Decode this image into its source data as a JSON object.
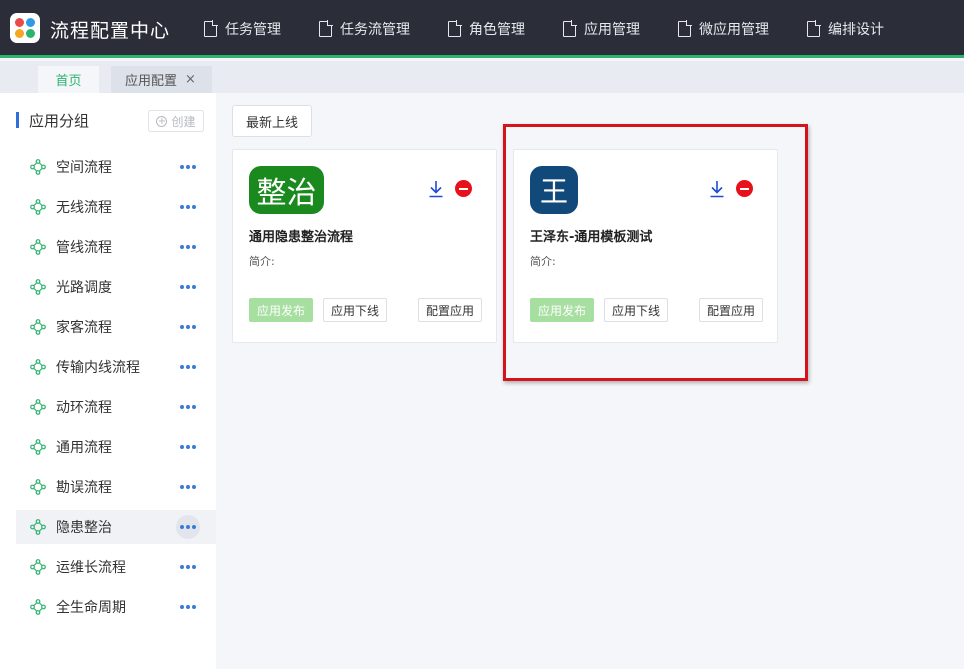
{
  "header": {
    "app_title": "流程配置中心",
    "logo_colors": [
      "#e94b4b",
      "#2f9be4",
      "#f5a623",
      "#2cb36d"
    ],
    "nav": [
      {
        "label": "任务管理"
      },
      {
        "label": "任务流管理"
      },
      {
        "label": "角色管理"
      },
      {
        "label": "应用管理"
      },
      {
        "label": "微应用管理"
      },
      {
        "label": "编排设计"
      }
    ]
  },
  "tabs": [
    {
      "label": "首页",
      "active": true
    },
    {
      "label": "应用配置",
      "active": false,
      "close_icon": "×"
    }
  ],
  "sidebar": {
    "title": "应用分组",
    "create_label": "创建",
    "items": [
      {
        "label": "空间流程",
        "active": false
      },
      {
        "label": "无线流程",
        "active": false
      },
      {
        "label": "管线流程",
        "active": false
      },
      {
        "label": "光路调度",
        "active": false
      },
      {
        "label": "家客流程",
        "active": false
      },
      {
        "label": "传输内线流程",
        "active": false
      },
      {
        "label": "动环流程",
        "active": false
      },
      {
        "label": "通用流程",
        "active": false
      },
      {
        "label": "勘误流程",
        "active": false
      },
      {
        "label": "隐患整治",
        "active": true
      },
      {
        "label": "运维长流程",
        "active": false
      },
      {
        "label": "全生命周期",
        "active": false
      }
    ]
  },
  "main": {
    "filter_label": "最新上线",
    "cards": [
      {
        "logo_text": "整治",
        "logo_color": "#1a8a1f",
        "name": "通用隐患整治流程",
        "desc": "简介:",
        "publish_label": "应用发布",
        "offline_label": "应用下线",
        "config_label": "配置应用"
      },
      {
        "logo_text": "王",
        "logo_color": "#114a7a",
        "name": "王泽东-通用模板测试",
        "desc": "简介:",
        "publish_label": "应用发布",
        "offline_label": "应用下线",
        "config_label": "配置应用"
      }
    ]
  },
  "colors": {
    "topbar": "#2b2e38",
    "accent_green": "#2cb36d",
    "highlight_red": "#d4141c"
  }
}
